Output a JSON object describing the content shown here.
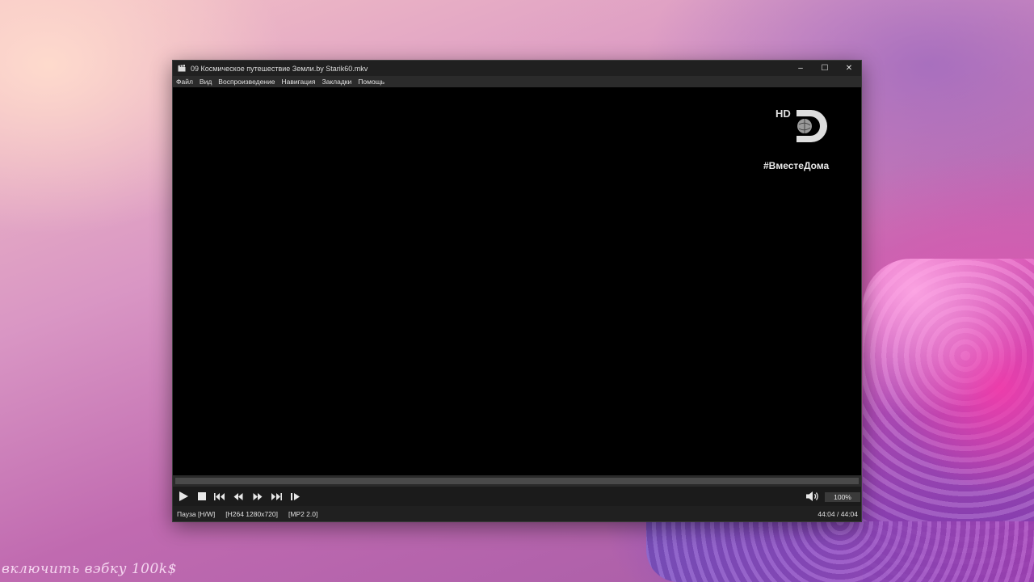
{
  "window": {
    "title": "09 Космическое путешествие Земли.by Starik60.mkv",
    "controls": {
      "minimize": "–",
      "maximize": "☐",
      "close": "✕"
    }
  },
  "menu": {
    "items": [
      {
        "label": "Файл"
      },
      {
        "label": "Вид"
      },
      {
        "label": "Воспроизведение"
      },
      {
        "label": "Навигация"
      },
      {
        "label": "Закладки"
      },
      {
        "label": "Помощь"
      }
    ]
  },
  "video": {
    "channel_logo_text": "HD",
    "hashtag": "#ВместеДома"
  },
  "playback": {
    "progress": 1.0,
    "volume_label": "100%"
  },
  "status": {
    "state": "Пауза [H/W]",
    "video_codec": "[H264 1280x720]",
    "audio_codec": "[MP2 2.0]",
    "time": "44:04 / 44:04"
  },
  "desktop": {
    "watermark": "включить вэбку 100k$"
  },
  "colors": {
    "titlebar": "#202020",
    "menubar": "#2b2b2b",
    "controls_bg": "#1b1b1b",
    "icon": "#e8e8e8"
  }
}
